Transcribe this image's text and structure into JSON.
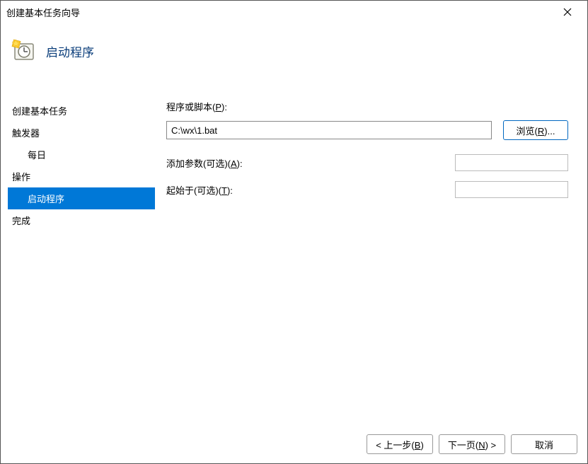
{
  "window": {
    "title": "创建基本任务向导"
  },
  "header": {
    "title": "启动程序"
  },
  "sidebar": {
    "step1": "创建基本任务",
    "step2": "触发器",
    "step2sub": "每日",
    "step3": "操作",
    "step3sub": "启动程序",
    "step4": "完成"
  },
  "form": {
    "program_label_pre": "程序或脚本(",
    "program_label_u": "P",
    "program_label_post": "):",
    "program_value": "C:\\wx\\1.bat",
    "browse_pre": "浏览(",
    "browse_u": "R",
    "browse_post": ")...",
    "args_label_pre": "添加参数(可选)(",
    "args_label_u": "A",
    "args_label_post": "):",
    "args_value": "",
    "startin_label_pre": "起始于(可选)(",
    "startin_label_u": "T",
    "startin_label_post": "):",
    "startin_value": ""
  },
  "footer": {
    "back_pre": "< 上一步(",
    "back_u": "B",
    "back_post": ")",
    "next_pre": "下一页(",
    "next_u": "N",
    "next_post": ") >",
    "cancel": "取消"
  }
}
